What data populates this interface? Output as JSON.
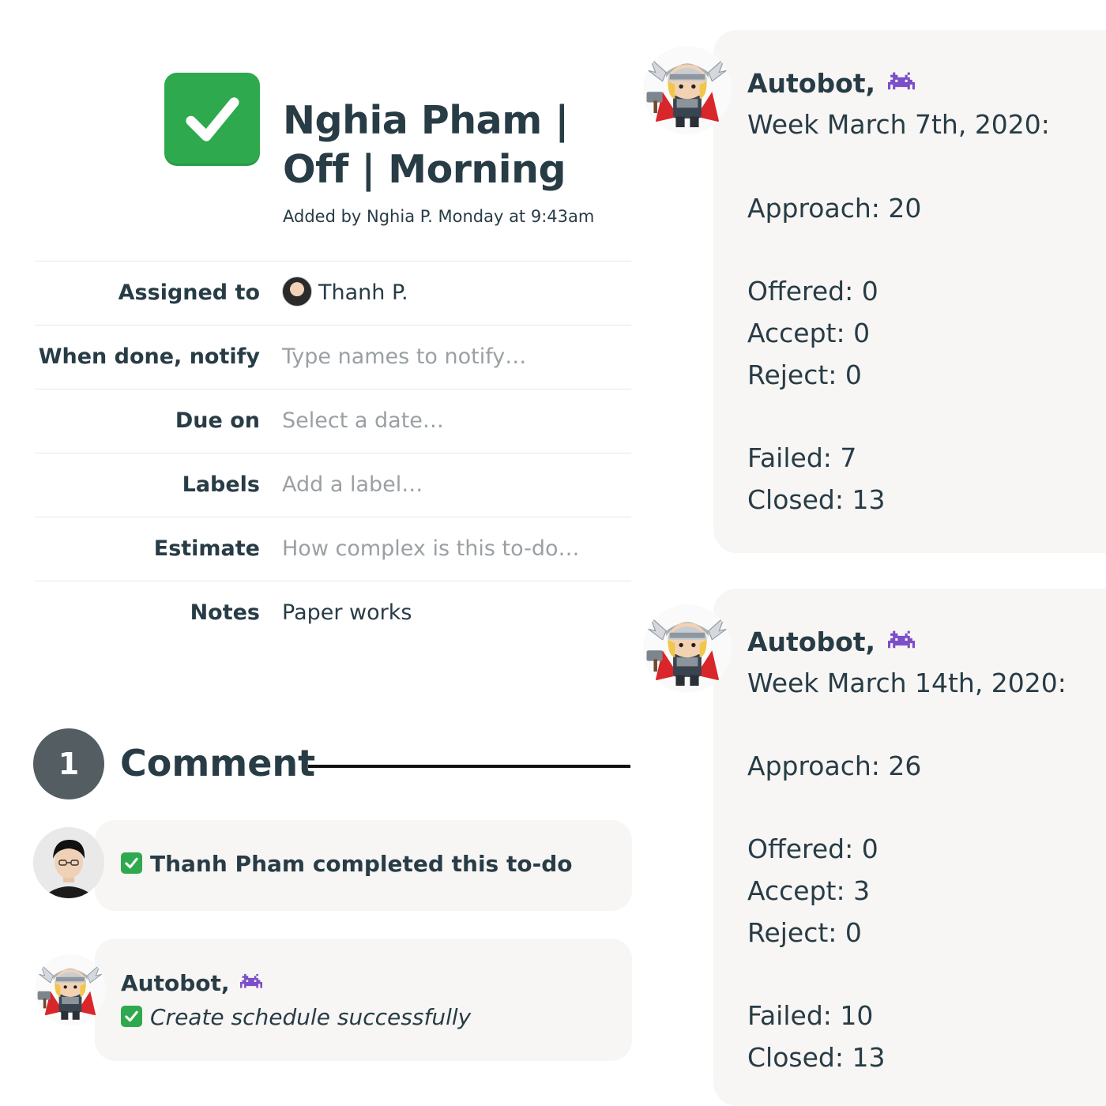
{
  "todo": {
    "title": "Nghia Pham | Off | Morning",
    "meta": "Added by Nghia P. Monday at 9:43am"
  },
  "details": {
    "assigned_label": "Assigned to",
    "assigned_value": "Thanh P.",
    "notify_label": "When done, notify",
    "notify_placeholder": "Type names to notify…",
    "due_label": "Due on",
    "due_placeholder": "Select a date…",
    "labels_label": "Labels",
    "labels_placeholder": "Add a label…",
    "estimate_label": "Estimate",
    "estimate_placeholder": "How complex is this to-do…",
    "notes_label": "Notes",
    "notes_value": "Paper works"
  },
  "comments": {
    "count": "1",
    "heading": "Comment",
    "events": [
      {
        "text": "Thanh Pham completed this to-do"
      },
      {
        "author": "Autobot,",
        "text": "Create schedule successfully"
      }
    ]
  },
  "reports": [
    {
      "author": "Autobot,",
      "week": "Week March 7th, 2020:",
      "approach": "Approach: 20",
      "offered": "Offered: 0",
      "accept": "Accept: 0",
      "reject": "Reject: 0",
      "failed": "Failed: 7",
      "closed": "Closed: 13"
    },
    {
      "author": "Autobot,",
      "week": "Week March 14th, 2020:",
      "approach": "Approach: 26",
      "offered": "Offered: 0",
      "accept": "Accept: 3",
      "reject": "Reject: 0",
      "failed": "Failed: 10",
      "closed": "Closed: 13"
    }
  ],
  "icons": {
    "todo_check": "checkmark-icon",
    "bot_badge": "alien-monster-icon",
    "bot_avatar": "thor-avatar",
    "user_avatar": "user-photo-avatar"
  },
  "colors": {
    "check_green": "#2fa94e",
    "text": "#283c46",
    "placeholder": "#9aa0a3",
    "bubble": "#f7f6f4",
    "count_badge": "#535d62",
    "bot_purple": "#7b4fc7"
  }
}
